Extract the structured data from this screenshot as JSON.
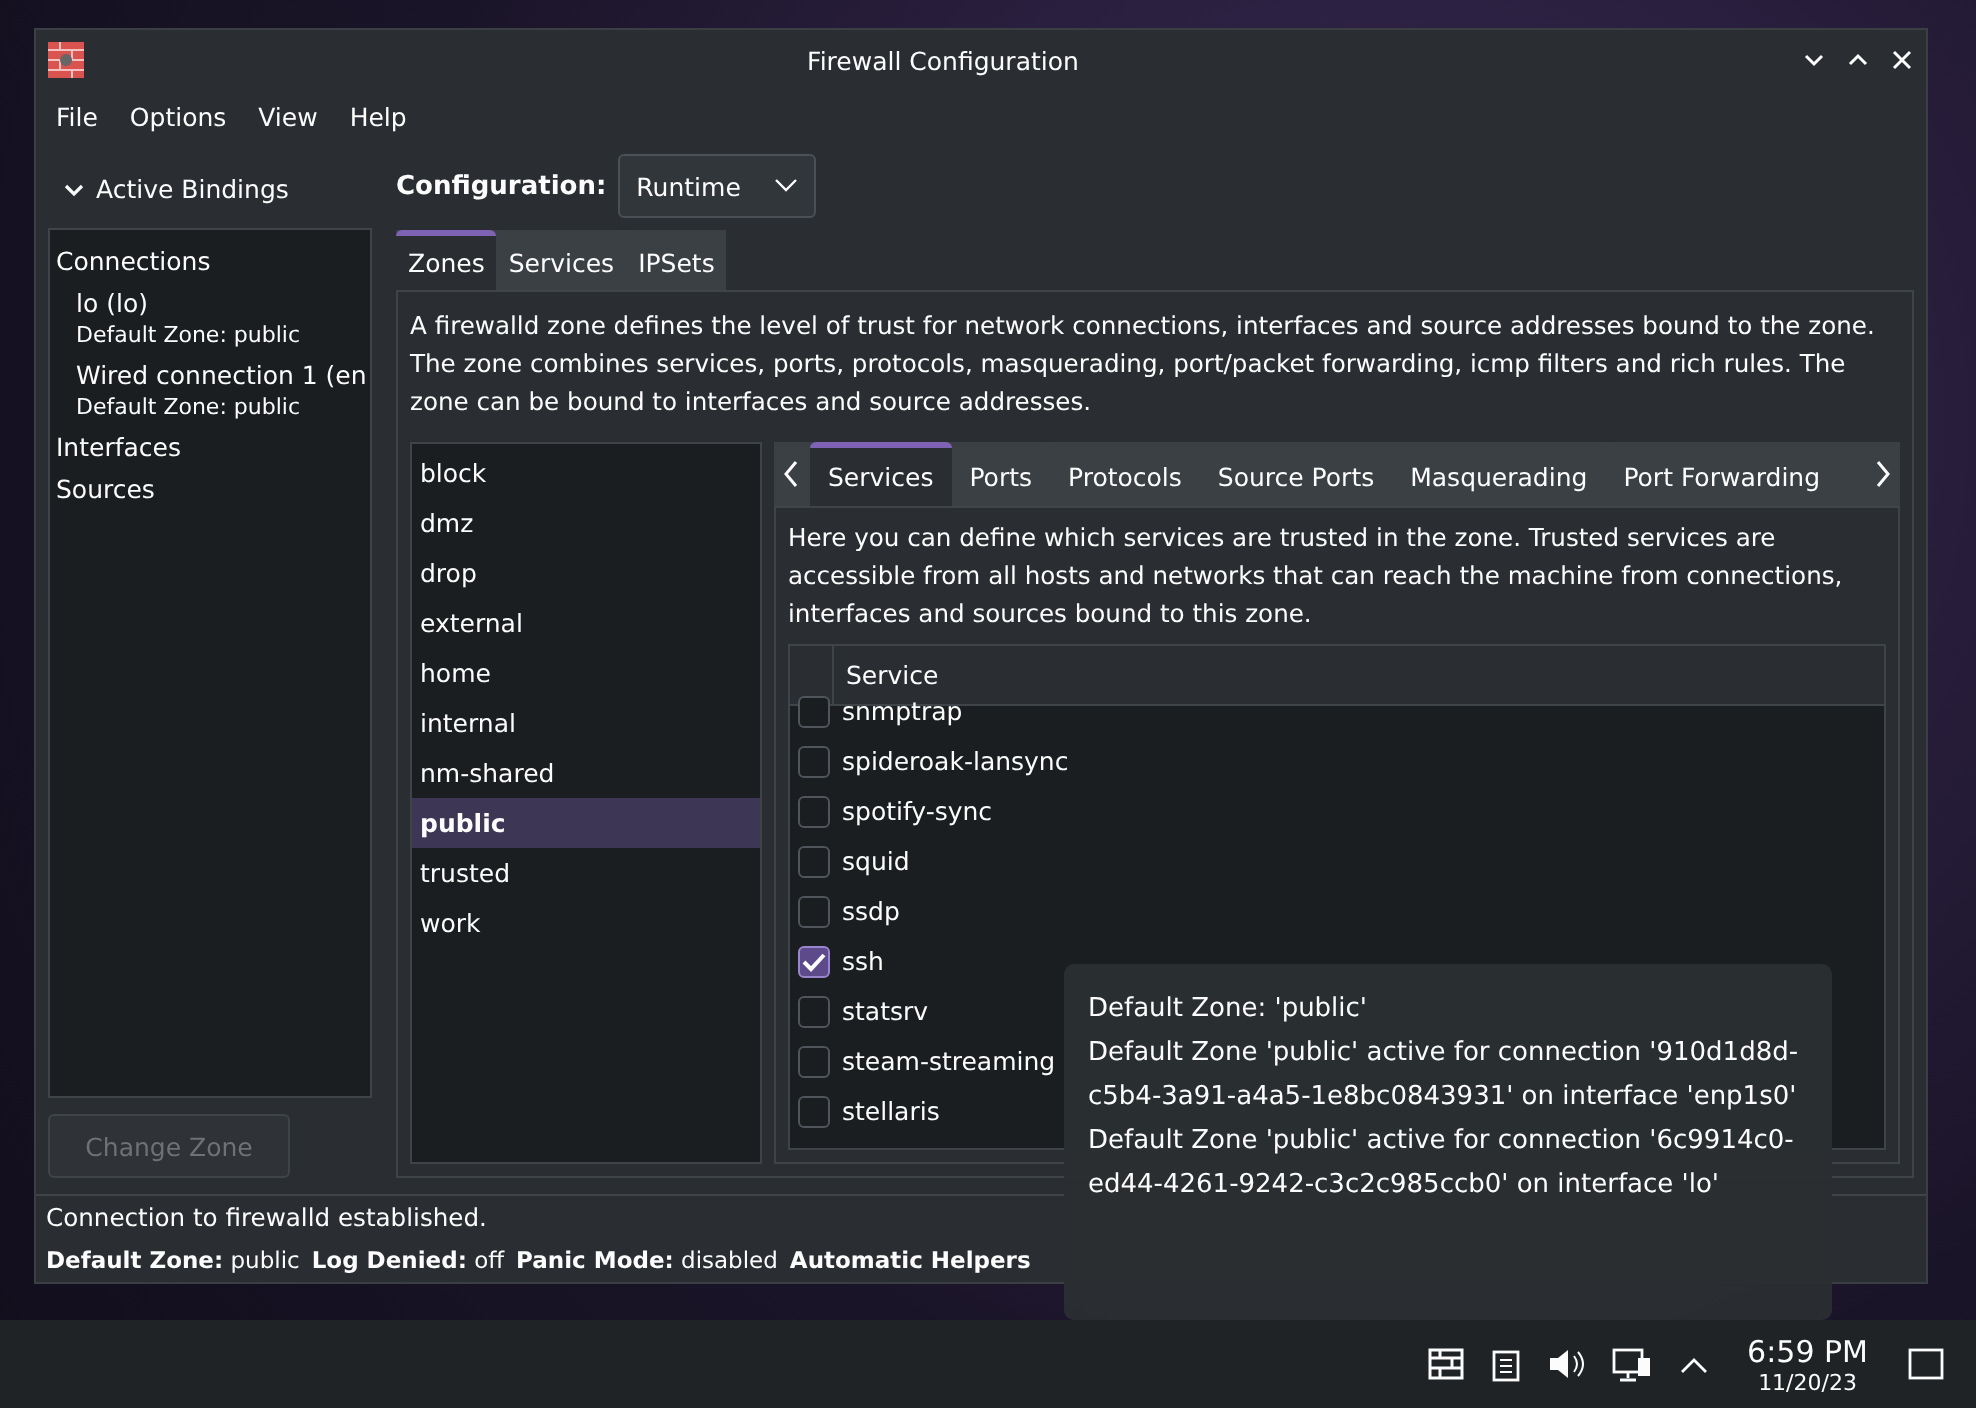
{
  "window": {
    "title": "Firewall Configuration"
  },
  "menu": [
    "File",
    "Options",
    "View",
    "Help"
  ],
  "sidebar": {
    "header": {
      "label": "Active Bindings",
      "expanded": true
    },
    "tree": [
      {
        "label": "Connections",
        "children": [
          {
            "label": "lo (lo)",
            "detail": "Default Zone: public"
          },
          {
            "label": "Wired connection 1 (en",
            "detail": "Default Zone: public"
          }
        ]
      },
      {
        "label": "Interfaces"
      },
      {
        "label": "Sources"
      }
    ],
    "button": {
      "label": "Change Zone",
      "disabled": true
    }
  },
  "configuration": {
    "label": "Configuration:",
    "value": "Runtime"
  },
  "tabs": [
    {
      "label": "Zones",
      "selected": true
    },
    {
      "label": "Services",
      "selected": false
    },
    {
      "label": "IPSets",
      "selected": false
    }
  ],
  "zone_description": "A firewalld zone defines the level of trust for network connections, interfaces and source addresses bound to the zone. The zone combines services, ports, protocols, masquerading, port/packet forwarding, icmp filters and rich rules. The zone can be bound to interfaces and source addresses.",
  "zones": [
    {
      "label": "block",
      "selected": false
    },
    {
      "label": "dmz",
      "selected": false
    },
    {
      "label": "drop",
      "selected": false
    },
    {
      "label": "external",
      "selected": false
    },
    {
      "label": "home",
      "selected": false
    },
    {
      "label": "internal",
      "selected": false
    },
    {
      "label": "nm-shared",
      "selected": false
    },
    {
      "label": "public",
      "selected": true
    },
    {
      "label": "trusted",
      "selected": false
    },
    {
      "label": "work",
      "selected": false
    }
  ],
  "zone_tabs": [
    {
      "label": "Services",
      "selected": true
    },
    {
      "label": "Ports",
      "selected": false
    },
    {
      "label": "Protocols",
      "selected": false
    },
    {
      "label": "Source Ports",
      "selected": false
    },
    {
      "label": "Masquerading",
      "selected": false
    },
    {
      "label": "Port Forwarding",
      "selected": false
    }
  ],
  "services_description": "Here you can define which services are trusted in the zone. Trusted services are accessible from all hosts and networks that can reach the machine from connections, interfaces and sources bound to this zone.",
  "services_table": {
    "column": "Service",
    "rows": [
      {
        "name": "snmptrap",
        "checked": false
      },
      {
        "name": "spideroak-lansync",
        "checked": false
      },
      {
        "name": "spotify-sync",
        "checked": false
      },
      {
        "name": "squid",
        "checked": false
      },
      {
        "name": "ssdp",
        "checked": false
      },
      {
        "name": "ssh",
        "checked": true
      },
      {
        "name": "statsrv",
        "checked": false
      },
      {
        "name": "steam-streaming",
        "checked": false
      },
      {
        "name": "stellaris",
        "checked": false
      }
    ]
  },
  "status_bar": {
    "message": "Connection to firewalld established.",
    "items": [
      {
        "label": "Default Zone:",
        "value": "public"
      },
      {
        "label": "Log Denied:",
        "value": "off"
      },
      {
        "label": "Panic Mode:",
        "value": "disabled"
      },
      {
        "label": "Automatic Helpers"
      }
    ]
  },
  "tooltip": {
    "lines": [
      "Default Zone: 'public'",
      "Default Zone 'public' active for connection '910d1d8d-c5b4-3a91-a4a5-1e8bc0843931' on interface 'enp1s0'",
      "Default Zone 'public' active for connection '6c9914c0-ed44-4261-9242-c3c2c985ccb0' on interface 'lo'"
    ]
  },
  "taskbar": {
    "time": "6:59 PM",
    "date": "11/20/23"
  }
}
